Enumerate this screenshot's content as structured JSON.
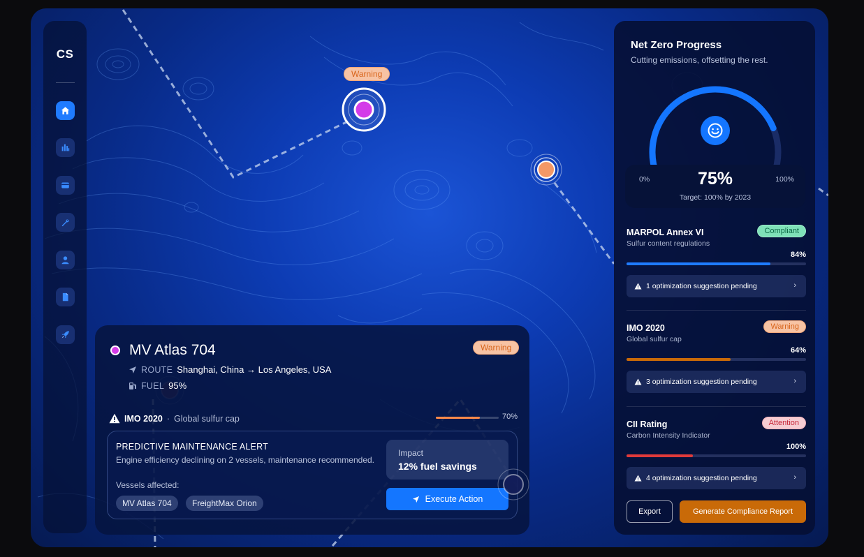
{
  "brand": {
    "logo": "CS"
  },
  "sidebar": {
    "items": [
      {
        "icon": "home-icon",
        "active": true
      },
      {
        "icon": "bar-chart-icon",
        "active": false
      },
      {
        "icon": "card-icon",
        "active": false
      },
      {
        "icon": "wrench-icon",
        "active": false
      },
      {
        "icon": "user-icon",
        "active": false
      },
      {
        "icon": "document-icon",
        "active": false
      },
      {
        "icon": "rocket-icon",
        "active": false
      }
    ]
  },
  "map": {
    "warning_marker_label": "Warning"
  },
  "vessel": {
    "name": "MV Atlas 704",
    "status": "Warning",
    "route_label": "ROUTE",
    "route_value": "Shanghai, China → Los Angeles, USA",
    "fuel_label": "FUEL",
    "fuel_value": "95%",
    "regulation": "IMO 2020",
    "regulation_sep": "·",
    "regulation_desc": "Global sulfur cap",
    "progress_text": "70%",
    "progress": 0.7,
    "alert": {
      "title": "PREDICTIVE MAINTENANCE ALERT",
      "description": "Engine efficiency declining on 2 vessels, maintenance recommended.",
      "vessels_label": "Vessels affected:",
      "vessels": [
        "MV Atlas 704",
        "FreightMax Orion"
      ],
      "impact_label": "Impact",
      "impact_value": "12% fuel savings",
      "action_label": "Execute Action"
    }
  },
  "panel": {
    "title": "Net Zero Progress",
    "subtitle": "Cutting emissions, offsetting the rest.",
    "gauge": {
      "value": "75%",
      "progress": 0.75,
      "min": "0%",
      "max": "100%",
      "target": "Target: 100% by 2023"
    },
    "regulations": [
      {
        "name": "MARPOL Annex VI",
        "desc": "Sulfur content regulations",
        "status": "Compliant",
        "percent": "84%",
        "progress": 0.8,
        "color": "#1f7bff",
        "suggestion": "1 optimization suggestion pending"
      },
      {
        "name": "IMO 2020",
        "desc": "Global sulfur cap",
        "status": "Warning",
        "percent": "64%",
        "progress": 0.58,
        "color": "#c96a08",
        "suggestion": "3 optimization suggestion pending"
      },
      {
        "name": "CII Rating",
        "desc": "Carbon Intensity Indicator",
        "status": "Attention",
        "percent": "100%",
        "progress": 0.37,
        "color": "#e03a3a",
        "suggestion": "4 optimization suggestion pending"
      }
    ],
    "export_label": "Export",
    "report_label": "Generate Compliance Report"
  }
}
